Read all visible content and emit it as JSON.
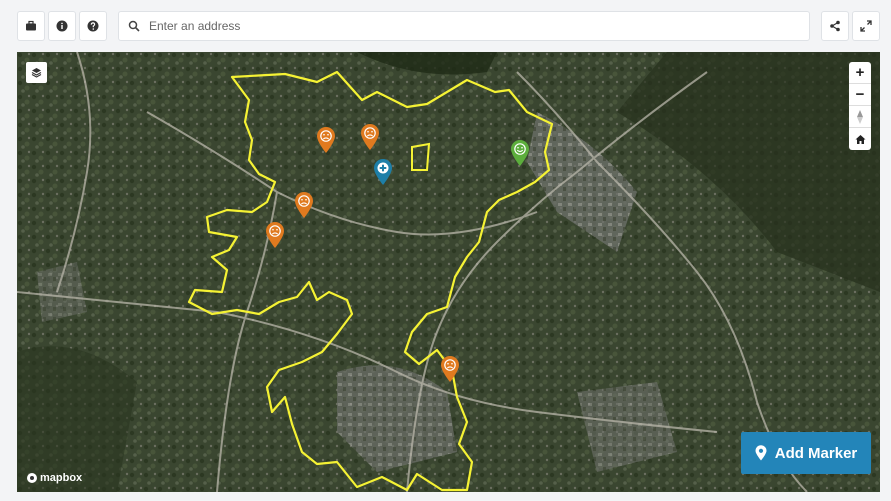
{
  "toolbar": {
    "left_buttons": [
      {
        "icon": "briefcase-icon"
      },
      {
        "icon": "info-icon"
      },
      {
        "icon": "help-icon"
      }
    ],
    "right_buttons": [
      {
        "icon": "share-icon"
      },
      {
        "icon": "fullscreen-icon"
      }
    ]
  },
  "search": {
    "placeholder": "Enter an address",
    "value": ""
  },
  "map": {
    "attribution": "mapbox",
    "boundary_color": "#f5f234",
    "markers": [
      {
        "type": "negative",
        "color": "#e07a1f",
        "icon": "sad-face-icon"
      },
      {
        "type": "negative",
        "color": "#e07a1f",
        "icon": "sad-face-icon"
      },
      {
        "type": "location",
        "color": "#1e7fa8",
        "icon": "plus-icon"
      },
      {
        "type": "positive",
        "color": "#5cae3c",
        "icon": "smile-face-icon"
      },
      {
        "type": "negative",
        "color": "#e07a1f",
        "icon": "sad-face-icon"
      },
      {
        "type": "negative",
        "color": "#e07a1f",
        "icon": "sad-face-icon"
      },
      {
        "type": "negative",
        "color": "#e07a1f",
        "icon": "sad-face-icon"
      }
    ],
    "controls": {
      "zoom_in": "+",
      "zoom_out": "−"
    }
  },
  "add_marker": {
    "label": "Add Marker",
    "color": "#2385b9"
  }
}
